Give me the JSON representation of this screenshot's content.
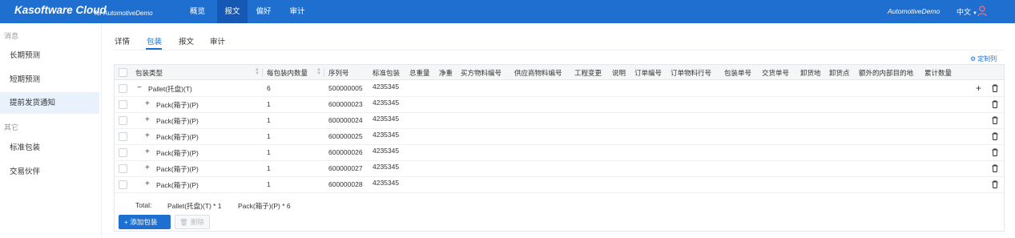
{
  "topbar": {
    "brand": "Kasoftware Cloud",
    "brand_sub": "for AutomotiveDemo",
    "nav": [
      "概览",
      "报文",
      "偏好",
      "审计"
    ],
    "active_nav": "报文",
    "user": "AutomotiveDemo",
    "language": "中文",
    "accent_color": "#1f6fd1"
  },
  "sidebar": {
    "groups": [
      {
        "label": "消息",
        "items": [
          "长期预测",
          "短期预测",
          "提前发货通知"
        ]
      },
      {
        "label": "其它",
        "items": [
          "标准包装",
          "交易伙伴"
        ]
      }
    ],
    "active_item": "提前发货通知"
  },
  "tabs": [
    "详情",
    "包装",
    "报文",
    "审计"
  ],
  "active_tab": "包装",
  "customize_columns": "定制列",
  "table": {
    "columns": [
      "包装类型",
      "每包装内数量",
      "序列号",
      "标准包装",
      "总重量",
      "净重",
      "买方物料编号",
      "供应商物料编号",
      "工程变更",
      "说明",
      "订单编号",
      "订单物料行号",
      "包装单号",
      "交货单号",
      "卸货地",
      "卸货点",
      "额外的内部目的地",
      "累计数量"
    ],
    "rows": [
      {
        "expander": "−",
        "type": "Pallet(托盘)(T)",
        "qty": "6",
        "serial": "500000005",
        "std_pack": "4235345"
      },
      {
        "expander": "+",
        "type": "Pack(箱子)(P)",
        "qty": "1",
        "serial": "600000023",
        "std_pack": "4235345"
      },
      {
        "expander": "+",
        "type": "Pack(箱子)(P)",
        "qty": "1",
        "serial": "600000024",
        "std_pack": "4235345"
      },
      {
        "expander": "+",
        "type": "Pack(箱子)(P)",
        "qty": "1",
        "serial": "600000025",
        "std_pack": "4235345"
      },
      {
        "expander": "+",
        "type": "Pack(箱子)(P)",
        "qty": "1",
        "serial": "600000026",
        "std_pack": "4235345"
      },
      {
        "expander": "+",
        "type": "Pack(箱子)(P)",
        "qty": "1",
        "serial": "600000027",
        "std_pack": "4235345"
      },
      {
        "expander": "+",
        "type": "Pack(箱子)(P)",
        "qty": "1",
        "serial": "600000028",
        "std_pack": "4235345"
      }
    ],
    "total_label": "Total:",
    "total_pallet": "Pallet(托盘)(T) * 1",
    "total_pack": "Pack(箱子)(P) * 6"
  },
  "actions": {
    "add": "+ 添加包装",
    "delete": "删除"
  }
}
